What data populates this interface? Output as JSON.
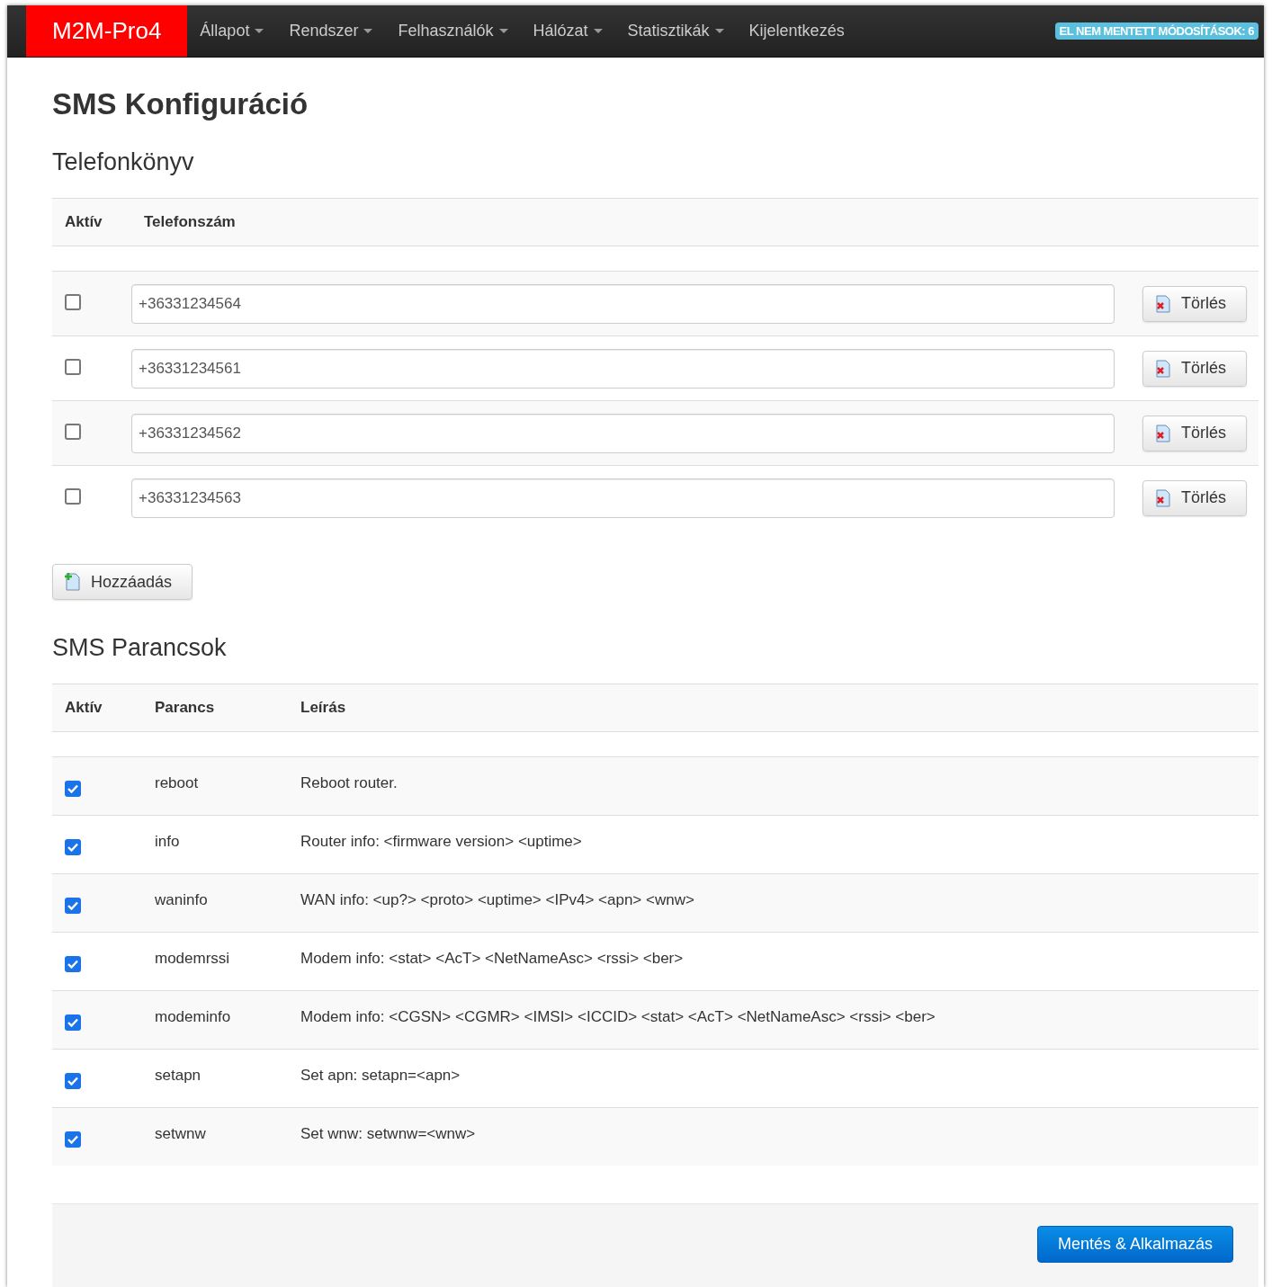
{
  "navbar": {
    "brand": "M2M-Pro4",
    "items": [
      {
        "label": "Állapot",
        "dropdown": true
      },
      {
        "label": "Rendszer",
        "dropdown": true
      },
      {
        "label": "Felhasználók",
        "dropdown": true
      },
      {
        "label": "Hálózat",
        "dropdown": true
      },
      {
        "label": "Statisztikák",
        "dropdown": true
      },
      {
        "label": "Kijelentkezés",
        "dropdown": false
      }
    ],
    "badge": "EL NEM MENTETT MÓDOSÍTÁSOK: 6"
  },
  "title": "SMS Konfiguráció",
  "phonebook": {
    "title": "Telefonkönyv",
    "columns": [
      "Aktív",
      "Telefonszám"
    ],
    "rows": [
      {
        "checked": false,
        "number": "+36331234564",
        "delete": "Törlés"
      },
      {
        "checked": false,
        "number": "+36331234561",
        "delete": "Törlés"
      },
      {
        "checked": false,
        "number": "+36331234562",
        "delete": "Törlés"
      },
      {
        "checked": false,
        "number": "+36331234563",
        "delete": "Törlés"
      }
    ],
    "add_button": "Hozzáadás"
  },
  "commands": {
    "title": "SMS Parancsok",
    "columns": [
      "Aktív",
      "Parancs",
      "Leírás"
    ],
    "rows": [
      {
        "checked": true,
        "command": "reboot",
        "description": "Reboot router."
      },
      {
        "checked": true,
        "command": "info",
        "description": "Router info: <firmware version> <uptime>"
      },
      {
        "checked": true,
        "command": "waninfo",
        "description": "WAN info: <up?> <proto> <uptime> <IPv4> <apn> <wnw>"
      },
      {
        "checked": true,
        "command": "modemrssi",
        "description": "Modem info: <stat> <AcT> <NetNameAsc> <rssi> <ber>"
      },
      {
        "checked": true,
        "command": "modeminfo",
        "description": "Modem info: <CGSN> <CGMR> <IMSI> <ICCID> <stat> <AcT> <NetNameAsc> <rssi> <ber>"
      },
      {
        "checked": true,
        "command": "setapn",
        "description": "Set apn: setapn=<apn>"
      },
      {
        "checked": true,
        "command": "setwnw",
        "description": "Set wnw: setwnw=<wnw>"
      }
    ]
  },
  "save_button": "Mentés & Alkalmazás"
}
